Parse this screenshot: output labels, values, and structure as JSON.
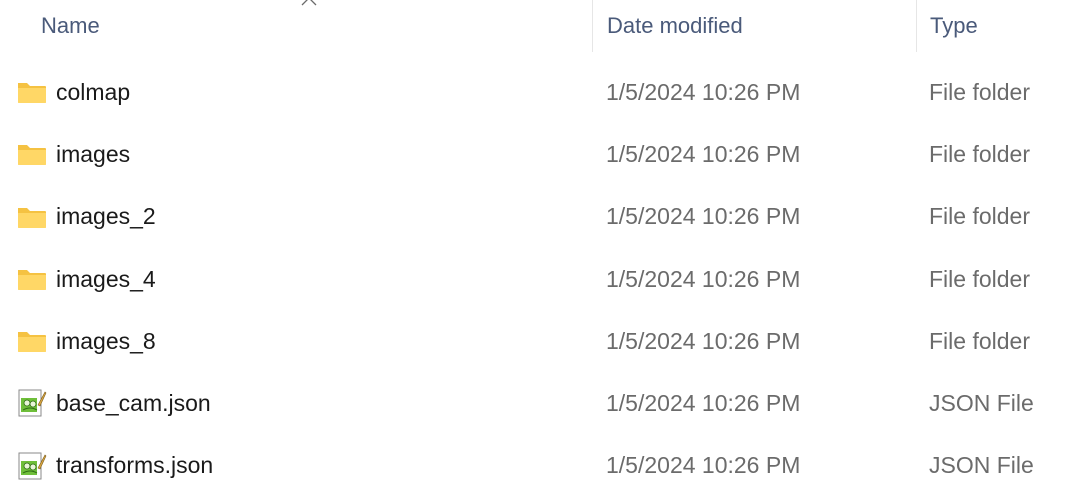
{
  "columns": {
    "name": "Name",
    "date": "Date modified",
    "type": "Type"
  },
  "sort": {
    "column": "name",
    "direction": "ascending"
  },
  "files": [
    {
      "name": "colmap",
      "date": "1/5/2024 10:26 PM",
      "type": "File folder",
      "icon": "folder-icon"
    },
    {
      "name": "images",
      "date": "1/5/2024 10:26 PM",
      "type": "File folder",
      "icon": "folder-icon"
    },
    {
      "name": "images_2",
      "date": "1/5/2024 10:26 PM",
      "type": "File folder",
      "icon": "folder-icon"
    },
    {
      "name": "images_4",
      "date": "1/5/2024 10:26 PM",
      "type": "File folder",
      "icon": "folder-icon"
    },
    {
      "name": "images_8",
      "date": "1/5/2024 10:26 PM",
      "type": "File folder",
      "icon": "folder-icon"
    },
    {
      "name": "base_cam.json",
      "date": "1/5/2024 10:26 PM",
      "type": "JSON File",
      "icon": "json-file-icon"
    },
    {
      "name": "transforms.json",
      "date": "1/5/2024 10:26 PM",
      "type": "JSON File",
      "icon": "json-file-icon"
    }
  ],
  "colors": {
    "folder": "#f5c242",
    "folder_front": "#ffd766",
    "header_text": "#4a5a7a",
    "detail_text": "#6b6b6b"
  }
}
